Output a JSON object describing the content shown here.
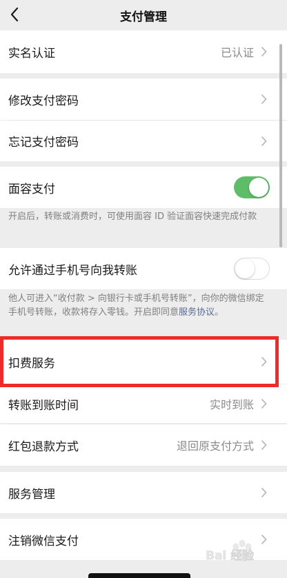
{
  "nav": {
    "title": "支付管理",
    "back_icon": "chevron-left-icon"
  },
  "rows": {
    "realname": {
      "label": "实名认证",
      "value": "已认证"
    },
    "change_password": {
      "label": "修改支付密码"
    },
    "forgot_password": {
      "label": "忘记支付密码"
    },
    "face_pay": {
      "label": "面容支付",
      "toggle": "on"
    },
    "phone_transfer": {
      "label": "允许通过手机号向我转账",
      "toggle": "off"
    },
    "deduction": {
      "label": "扣费服务"
    },
    "transfer_time": {
      "label": "转账到账时间",
      "value": "实时到账"
    },
    "redpacket_refund": {
      "label": "红包退款方式",
      "value": "退回原支付方式"
    },
    "service_manage": {
      "label": "服务管理"
    },
    "cancel_wechat_pay": {
      "label": "注销微信支付"
    }
  },
  "notes": {
    "face_pay": "开启后，转账或消费时，可使用面容 ID 验证面容快速完成付款",
    "phone_transfer_text": "他人可进入“收付款 > 向银行卡或手机号转账”，向你的微信绑定手机号转账，收款将存入零钱。开启即同意",
    "phone_transfer_link": "服务协议",
    "phone_transfer_end": "。"
  },
  "colors": {
    "toggle_on": "#5fbd6a",
    "link": "#576b95",
    "highlight": "#ee2b2b",
    "background": "#ededed"
  },
  "watermark": {
    "text": "Bai 经验"
  }
}
